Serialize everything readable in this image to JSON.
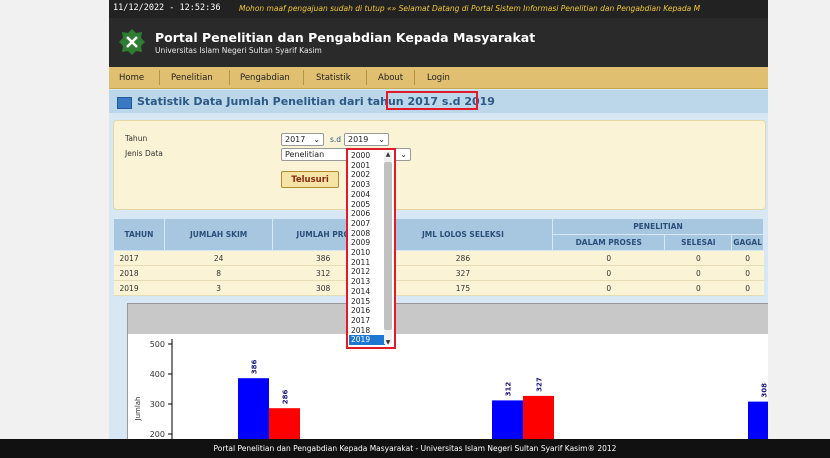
{
  "topbar": {
    "datetime": "11/12/2022 - 12:52:36",
    "marquee": "Mohon maaf pengajuan sudah di tutup «» Selamat Datang di Portal Sistem Informasi Penelitian dan Pengabdian Kepada M"
  },
  "header": {
    "title": "Portal Penelitian dan Pengabdian Kepada Masyarakat",
    "subtitle": "Universitas Islam Negeri Sultan Syarif Kasim"
  },
  "nav": [
    "Home",
    "Penelitian",
    "Pengabdian",
    "Statistik",
    "About",
    "Login"
  ],
  "page_title": {
    "prefix": "Statistik Data Jumlah Penelitian dari tahun ",
    "highlight": "2017 s.d 2019"
  },
  "form": {
    "tahun_label": "Tahun",
    "jenis_label": "Jenis Data",
    "year_from": "2017",
    "sd_label": "s.d",
    "year_to": "2019",
    "jenis_value": "Penelitian",
    "submit_label": "Telusuri"
  },
  "table": {
    "headers": {
      "tahun": "TAHUN",
      "skim": "JUMLAH SKIM",
      "proposal": "JUMLAH PRO",
      "lolos": "JML LOLOS SELEKSI",
      "penelitian": "PENELITIAN",
      "proses": "DALAM PROSES",
      "selesai": "SELESAI",
      "gagal": "GAGAL"
    },
    "rows": [
      {
        "tahun": "2017",
        "skim": "24",
        "proposal": "386",
        "lolos": "286",
        "proses": "0",
        "selesai": "0",
        "gagal": "0"
      },
      {
        "tahun": "2018",
        "skim": "8",
        "proposal": "312",
        "lolos": "327",
        "proses": "0",
        "selesai": "0",
        "gagal": "0"
      },
      {
        "tahun": "2019",
        "skim": "3",
        "proposal": "308",
        "lolos": "175",
        "proses": "0",
        "selesai": "0",
        "gagal": "0"
      }
    ]
  },
  "dropdown_options": [
    "2000",
    "2001",
    "2002",
    "2003",
    "2004",
    "2005",
    "2006",
    "2007",
    "2008",
    "2009",
    "2010",
    "2011",
    "2012",
    "2013",
    "2014",
    "2015",
    "2016",
    "2017",
    "2018",
    "2019"
  ],
  "dropdown_selected": "2019",
  "chart_data": {
    "type": "bar",
    "ylabel": "Jumlah",
    "yticks": [
      200,
      300,
      400,
      500
    ],
    "ylim": [
      170,
      540
    ],
    "groups": [
      {
        "values": [
          386,
          286
        ]
      },
      {
        "values": [
          312,
          327
        ]
      },
      {
        "values": [
          308
        ]
      }
    ],
    "colors": [
      "#0000ff",
      "#ff0000"
    ]
  },
  "footer": "Portal Penelitian dan Pengabdian Kepada Masyarakat - Universitas Islam Negeri Sultan Syarif Kasim® 2012"
}
